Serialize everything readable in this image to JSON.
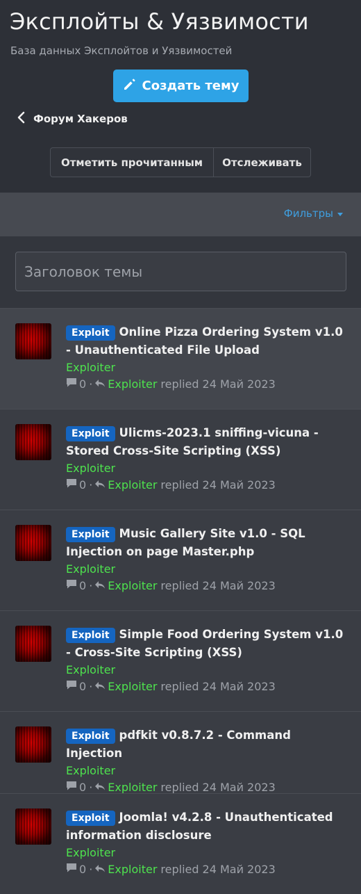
{
  "header": {
    "title": "Эксплойты & Уязвимости",
    "subtitle": "База данных Эксплойтов и Уязвимостей",
    "create_label": "Создать тему",
    "back_label": "Форум Хакеров",
    "mark_read_label": "Отметить прочитанным",
    "watch_label": "Отслеживать"
  },
  "filters": {
    "label": "Фильтры"
  },
  "search": {
    "placeholder": "Заголовок темы"
  },
  "threads": [
    {
      "tag": "Exploit",
      "title": "Online Pizza Ordering System v1.0 - Unauthenticated File Upload",
      "author": "Exploiter",
      "replies": "0",
      "last_user": "Exploiter",
      "replied_word": "replied",
      "date": "24 Май 2023"
    },
    {
      "tag": "Exploit",
      "title": "Ulicms-2023.1 sniffing-vicuna - Stored Cross-Site Scripting (XSS)",
      "author": "Exploiter",
      "replies": "0",
      "last_user": "Exploiter",
      "replied_word": "replied",
      "date": "24 Май 2023"
    },
    {
      "tag": "Exploit",
      "title": "Music Gallery Site v1.0 - SQL Injection on page Master.php",
      "author": "Exploiter",
      "replies": "0",
      "last_user": "Exploiter",
      "replied_word": "replied",
      "date": "24 Май 2023"
    },
    {
      "tag": "Exploit",
      "title": "Simple Food Ordering System v1.0 - Cross-Site Scripting (XSS)",
      "author": "Exploiter",
      "replies": "0",
      "last_user": "Exploiter",
      "replied_word": "replied",
      "date": "24 Май 2023"
    },
    {
      "tag": "Exploit",
      "title": "pdfkit v0.8.7.2 - Command Injection",
      "author": "Exploiter",
      "replies": "0",
      "last_user": "Exploiter",
      "replied_word": "replied",
      "date": "24 Май 2023"
    },
    {
      "tag": "Exploit",
      "title": "Joomla! v4.2.8 - Unauthenticated information disclosure",
      "author": "Exploiter",
      "replies": "0",
      "last_user": "Exploiter",
      "replied_word": "replied",
      "date": "24 Май 2023"
    }
  ],
  "colors": {
    "accent": "#2ea3e6",
    "tag": "#1565c0",
    "author": "#4ee34e",
    "link": "#3f9fe0"
  },
  "icons": {
    "create": "pencil-icon",
    "back": "chevron-left-icon",
    "replies": "comment-icon",
    "last_reply": "reply-icon"
  }
}
